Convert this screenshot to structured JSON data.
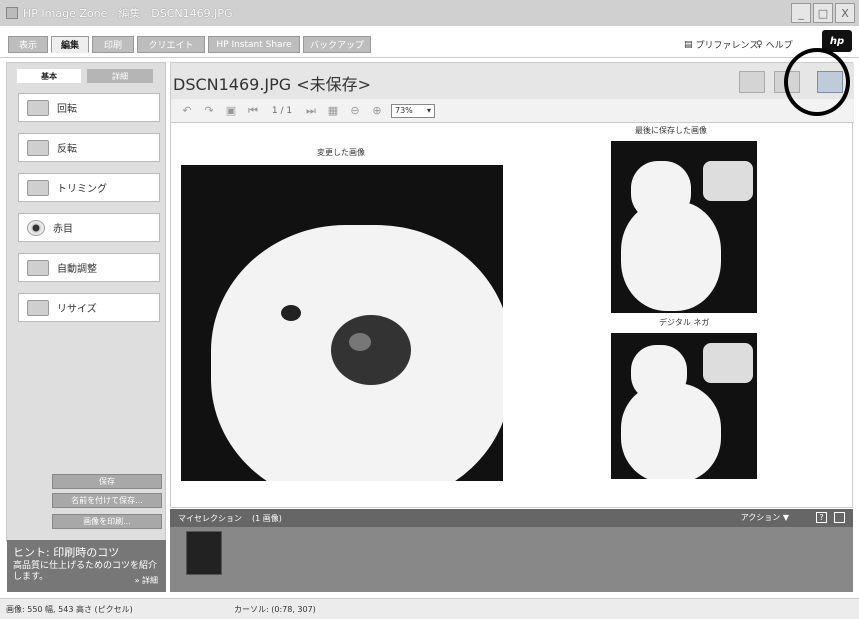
{
  "window": {
    "title": "HP Image Zone - 編集 - DSCN1469.JPG",
    "buttons": [
      "_",
      "□",
      "X"
    ]
  },
  "tabs": [
    {
      "label": "表示"
    },
    {
      "label": "編集",
      "active": true
    },
    {
      "label": "印刷"
    },
    {
      "label": "クリエイト"
    },
    {
      "label": "HP Instant Share"
    },
    {
      "label": "バックアップ"
    }
  ],
  "top_links": {
    "preferences": "プリファレンス",
    "help": "ヘルプ"
  },
  "logo": "hp",
  "sidebar": {
    "tabs": [
      "基本",
      "詳細"
    ],
    "tools": [
      {
        "label": "回転",
        "icon": "rotate-icon"
      },
      {
        "label": "反転",
        "icon": "flip-icon"
      },
      {
        "label": "トリミング",
        "icon": "crop-icon"
      },
      {
        "label": "赤目",
        "icon": "red-eye-icon"
      },
      {
        "label": "自動調整",
        "icon": "auto-adjust-icon"
      },
      {
        "label": "リサイズ",
        "icon": "resize-icon"
      }
    ],
    "buttons": {
      "save": "保存",
      "save_as": "名前を付けて保存...",
      "print": "画像を印刷..."
    },
    "hint": {
      "title": "ヒント: 印刷時のコツ",
      "body": "高品質に仕上げるためのコツを紹介します。",
      "more": "» 詳細"
    }
  },
  "document": {
    "title": "DSCN1469.JPG <未保存>",
    "page": "1 / 1",
    "zoom": "73%",
    "captions": {
      "changed": "変更した画像",
      "last_saved": "最後に保存した画像",
      "digital_negative": "デジタル ネガ"
    }
  },
  "selection": {
    "label": "マイセレクション",
    "count": "(1 画像)",
    "actions": "アクション ▼",
    "help": "?"
  },
  "status": {
    "image_size": "画像: 550 幅, 543 高さ (ピクセル)",
    "cursor": "カーソル: (0:78, 307)"
  },
  "colors": {
    "tab_active": "#eeeeee",
    "tab_inactive": "#bdbdbd",
    "panel": "#dedede",
    "hint_bg": "#777777",
    "strip": "#888888",
    "selected_view": "#bfcbd8"
  }
}
